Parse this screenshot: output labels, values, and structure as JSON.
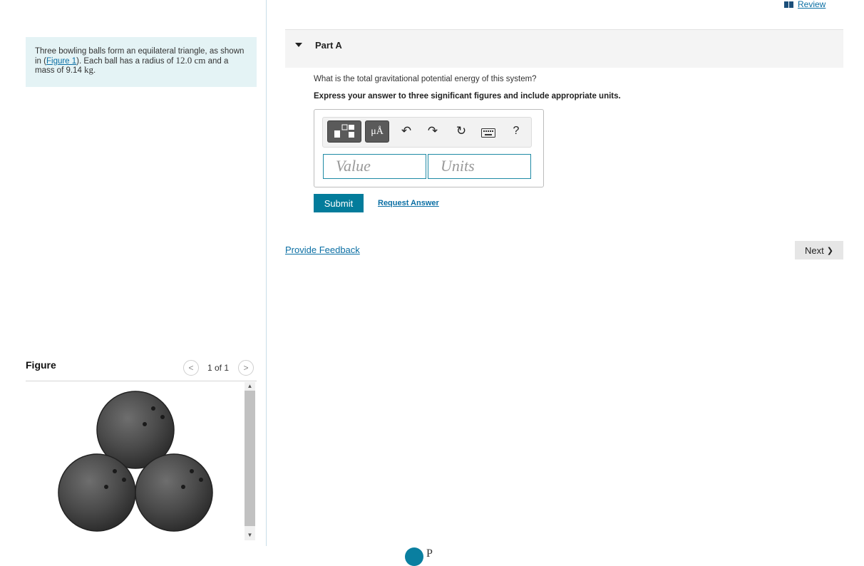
{
  "header": {
    "review_label": "Review"
  },
  "problem": {
    "text_before_link": "Three bowling balls form an equilateral triangle, as shown in (",
    "figure_link": "Figure 1",
    "text_after_link": "). Each ball has a radius of ",
    "radius_value": "12.0",
    "radius_unit": "cm",
    "text_mass": " and a mass of 9.14 ",
    "mass_unit": "kg",
    "text_end": "."
  },
  "figure_panel": {
    "title": "Figure",
    "prev_symbol": "<",
    "next_symbol": ">",
    "counter": "1 of 1"
  },
  "part": {
    "title": "Part A",
    "question": "What is the total gravitational potential energy of this system?",
    "instruction": "Express your answer to three significant figures and include appropriate units."
  },
  "toolbar": {
    "units_label": "μÅ",
    "undo_symbol": "↶",
    "redo_symbol": "↷",
    "reset_symbol": "↻",
    "help_label": "?"
  },
  "inputs": {
    "value_placeholder": "Value",
    "units_placeholder": "Units"
  },
  "actions": {
    "submit_label": "Submit",
    "request_answer_label": "Request Answer",
    "feedback_label": "Provide Feedback",
    "next_label": "Next",
    "next_symbol": "❯"
  },
  "footer": {
    "brand_text": "P"
  },
  "colors": {
    "accent": "#037c9b",
    "link": "#0b6fa4",
    "problem_bg": "#e4f3f5",
    "ball": "#4a4a4a"
  }
}
